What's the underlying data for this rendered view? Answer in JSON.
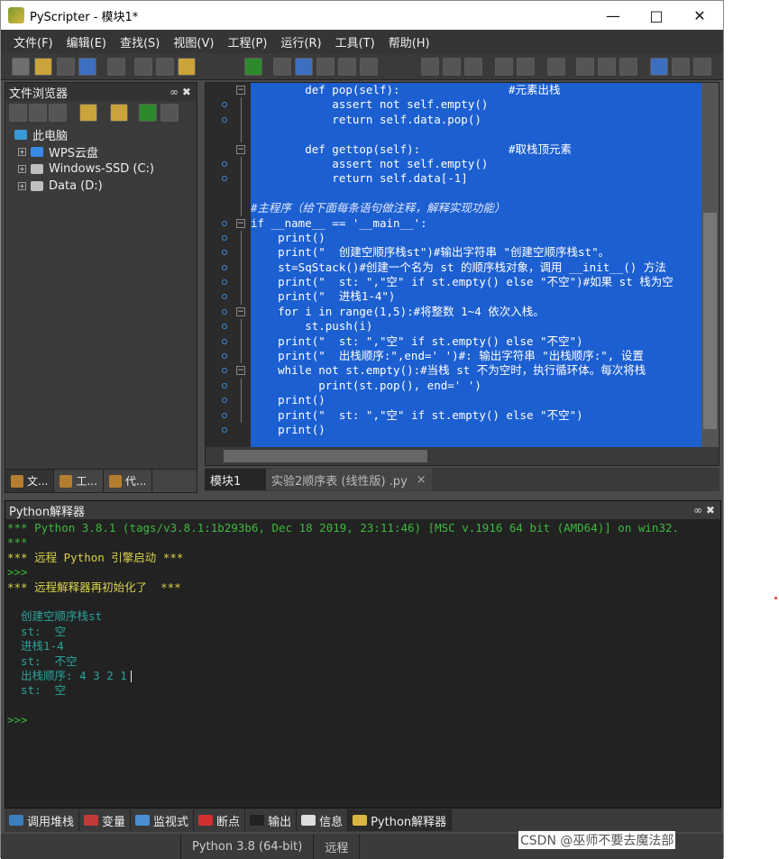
{
  "window": {
    "title": "PyScripter - 模块1*"
  },
  "menu": [
    "文件(F)",
    "编辑(E)",
    "查找(S)",
    "视图(V)",
    "工程(P)",
    "运行(R)",
    "工具(T)",
    "帮助(H)"
  ],
  "file_browser": {
    "title": "文件浏览器",
    "tree": [
      {
        "label": "此电脑",
        "icon": "monitor-icon"
      },
      {
        "label": "WPS云盘",
        "icon": "cloud-icon"
      },
      {
        "label": "Windows-SSD (C:)",
        "icon": "drive-icon"
      },
      {
        "label": "Data (D:)",
        "icon": "drive-icon"
      }
    ],
    "tabs": [
      "文...",
      "工...",
      "代..."
    ]
  },
  "editor": {
    "lines": [
      "        def pop(self):                #元素出栈",
      "            assert not self.empty()",
      "            return self.data.pop()",
      "",
      "        def gettop(self):             #取栈顶元素",
      "            assert not self.empty()",
      "            return self.data[-1]",
      "",
      "#主程序（给下面每条语句做注释，解释实现功能）",
      "if __name__ == '__main__':",
      "    print()",
      "    print(\"  创建空顺序栈st\")#输出字符串 \"创建空顺序栈st\"。",
      "    st=SqStack()#创建一个名为 st 的顺序栈对象，调用 __init__() 方法",
      "    print(\"  st: \",\"空\" if st.empty() else \"不空\")#如果 st 栈为空",
      "    print(\"  进栈1-4\")",
      "    for i in range(1,5):#将整数 1~4 依次入栈。",
      "        st.push(i)",
      "    print(\"  st: \",\"空\" if st.empty() else \"不空\")",
      "    print(\"  出栈顺序:\",end=' ')#: 输出字符串 \"出栈顺序:\", 设置",
      "    while not st.empty():#当栈 st 不为空时，执行循环体。每次将栈",
      "          print(st.pop(), end=' ')",
      "    print()",
      "    print(\"  st: \",\"空\" if st.empty() else \"不空\")",
      "    print()"
    ],
    "tabs": [
      {
        "label": "模块1"
      },
      {
        "label": "实验2顺序表 (线性版) .py"
      }
    ]
  },
  "interpreter": {
    "title": "Python解释器",
    "lines": [
      {
        "text": "*** Python 3.8.1 (tags/v3.8.1:1b293b6, Dec 18 2019, 23:11:46) [MSC v.1916 64 bit (AMD64)] on win32.",
        "kind": "sys"
      },
      {
        "text": "***",
        "kind": "sys"
      },
      {
        "text": "*** 远程 Python 引擎启动 ***",
        "kind": "hi"
      },
      {
        "text": ">>>",
        "kind": "sys"
      },
      {
        "text": "*** 远程解释器再初始化了  ***",
        "kind": "hi"
      },
      {
        "text": "",
        "kind": "out"
      },
      {
        "text": "  创建空顺序栈st",
        "kind": "out"
      },
      {
        "text": "  st:  空",
        "kind": "out"
      },
      {
        "text": "  进栈1-4",
        "kind": "out"
      },
      {
        "text": "  st:  不空",
        "kind": "out"
      },
      {
        "text": "  出栈顺序: 4 3 2 1",
        "kind": "out"
      },
      {
        "text": "  st:  空",
        "kind": "out"
      },
      {
        "text": "",
        "kind": "out"
      },
      {
        "text": ">>>",
        "kind": "sys"
      }
    ]
  },
  "bottom_tabs": [
    {
      "label": "调用堆栈",
      "color": "#3c7fbf"
    },
    {
      "label": "变量",
      "color": "#c43a3a"
    },
    {
      "label": "监视式",
      "color": "#4a8fcf"
    },
    {
      "label": "断点",
      "color": "#d23030"
    },
    {
      "label": "输出",
      "color": "#222222"
    },
    {
      "label": "信息",
      "color": "#dddddd"
    },
    {
      "label": "Python解释器",
      "color": "#d8b640"
    }
  ],
  "status": {
    "python_version": "Python 3.8 (64-bit)",
    "engine": "远程"
  },
  "watermark": "CSDN @巫师不要去魔法部"
}
